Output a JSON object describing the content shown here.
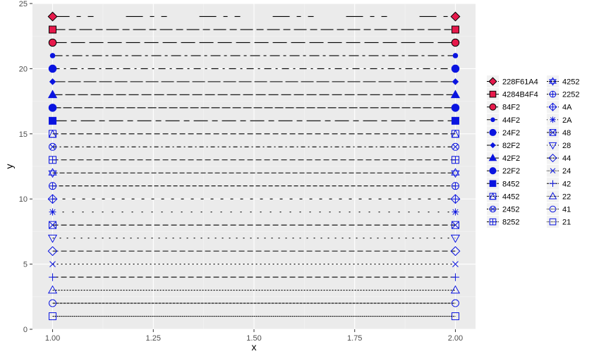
{
  "chart_data": {
    "type": "line",
    "title": "",
    "xlabel": "x",
    "ylabel": "y",
    "xlim": [
      0.95,
      2.05
    ],
    "ylim": [
      0,
      25
    ],
    "grid": true,
    "legend_position": "right",
    "x_ticks": [
      "1.00",
      "1.25",
      "1.50",
      "1.75",
      "2.00"
    ],
    "y_ticks": [
      "0",
      "5",
      "10",
      "15",
      "20",
      "25"
    ],
    "x": [
      1.0,
      2.0
    ],
    "series": [
      {
        "name": "228F61A4",
        "y": 24,
        "shape": "diamond",
        "filled": true,
        "fill": "#e6194b",
        "dash": "24 10 6 10 8 46"
      },
      {
        "name": "4284B4F4",
        "y": 23,
        "shape": "square",
        "filled": true,
        "fill": "#e6194b",
        "dash": "18 5 10 5"
      },
      {
        "name": "84F2",
        "y": 22,
        "shape": "circle",
        "filled": true,
        "fill": "#e6194b",
        "dash": "20 6"
      },
      {
        "name": "44F2",
        "y": 21,
        "shape": "small-circle",
        "filled": true,
        "fill": "#0a14e0",
        "dash": "14 5 4 5"
      },
      {
        "name": "24F2",
        "y": 20,
        "shape": "circle",
        "filled": true,
        "fill": "#0a14e0",
        "dash": "10 6 3 6"
      },
      {
        "name": "82F2",
        "y": 19,
        "shape": "small-diamond",
        "filled": true,
        "fill": "#0a14e0",
        "dash": "18 4"
      },
      {
        "name": "42F2",
        "y": 18,
        "shape": "triangle",
        "filled": true,
        "fill": "#0a14e0",
        "dash": "14 4"
      },
      {
        "name": "22F2",
        "y": 17,
        "shape": "circle",
        "filled": true,
        "fill": "#0a14e0",
        "dash": "12 3"
      },
      {
        "name": "8452",
        "y": 16,
        "shape": "square",
        "filled": true,
        "fill": "#0a14e0",
        "dash": "20 6 8 6"
      },
      {
        "name": "4452",
        "y": 15,
        "shape": "square-triangle",
        "filled": false,
        "fill": "none",
        "dash": "8 4"
      },
      {
        "name": "2452",
        "y": 14,
        "shape": "circle-x",
        "filled": false,
        "fill": "none",
        "dash": "6 4 2 4"
      },
      {
        "name": "8252",
        "y": 13,
        "shape": "square-plus",
        "filled": false,
        "fill": "none",
        "dash": "8 4"
      },
      {
        "name": "4252",
        "y": 12,
        "shape": "star-of-david",
        "filled": false,
        "fill": "none",
        "dash": "7 3"
      },
      {
        "name": "2252",
        "y": 11,
        "shape": "circle-plus",
        "filled": false,
        "fill": "none",
        "dash": "6 3"
      },
      {
        "name": "4A",
        "y": 10,
        "shape": "diamond-plus",
        "filled": false,
        "fill": "none",
        "dash": "4 10"
      },
      {
        "name": "2A",
        "y": 9,
        "shape": "asterisk",
        "filled": false,
        "fill": "none",
        "dash": "2 12"
      },
      {
        "name": "48",
        "y": 8,
        "shape": "square-x",
        "filled": false,
        "fill": "none",
        "dash": "8 4"
      },
      {
        "name": "28",
        "y": 7,
        "shape": "triangle-down",
        "filled": false,
        "fill": "none",
        "dash": "2 8"
      },
      {
        "name": "44",
        "y": 6,
        "shape": "open-diamond",
        "filled": false,
        "fill": "none",
        "dash": "8 4"
      },
      {
        "name": "24",
        "y": 5,
        "shape": "x",
        "filled": false,
        "fill": "none",
        "dash": "2 4"
      },
      {
        "name": "42",
        "y": 4,
        "shape": "plus",
        "filled": false,
        "fill": "none",
        "dash": "8 4"
      },
      {
        "name": "22",
        "y": 3,
        "shape": "open-triangle",
        "filled": false,
        "fill": "none",
        "dash": "2 2"
      },
      {
        "name": "41",
        "y": 2,
        "shape": "open-circle",
        "filled": false,
        "fill": "none",
        "dash": "4 1"
      },
      {
        "name": "21",
        "y": 1,
        "shape": "open-square",
        "filled": false,
        "fill": "none",
        "dash": "2 1"
      }
    ]
  },
  "colors": {
    "panel_background": "#ebebeb",
    "grid_major": "#ffffff",
    "grid_minor": "#f5f5f5",
    "line": "#000000",
    "marker_stroke": "#0a14e0",
    "marker_stroke_red": "#000000",
    "axis_text": "#4d4d4d",
    "legend_key_background": "#f2f2f2"
  }
}
